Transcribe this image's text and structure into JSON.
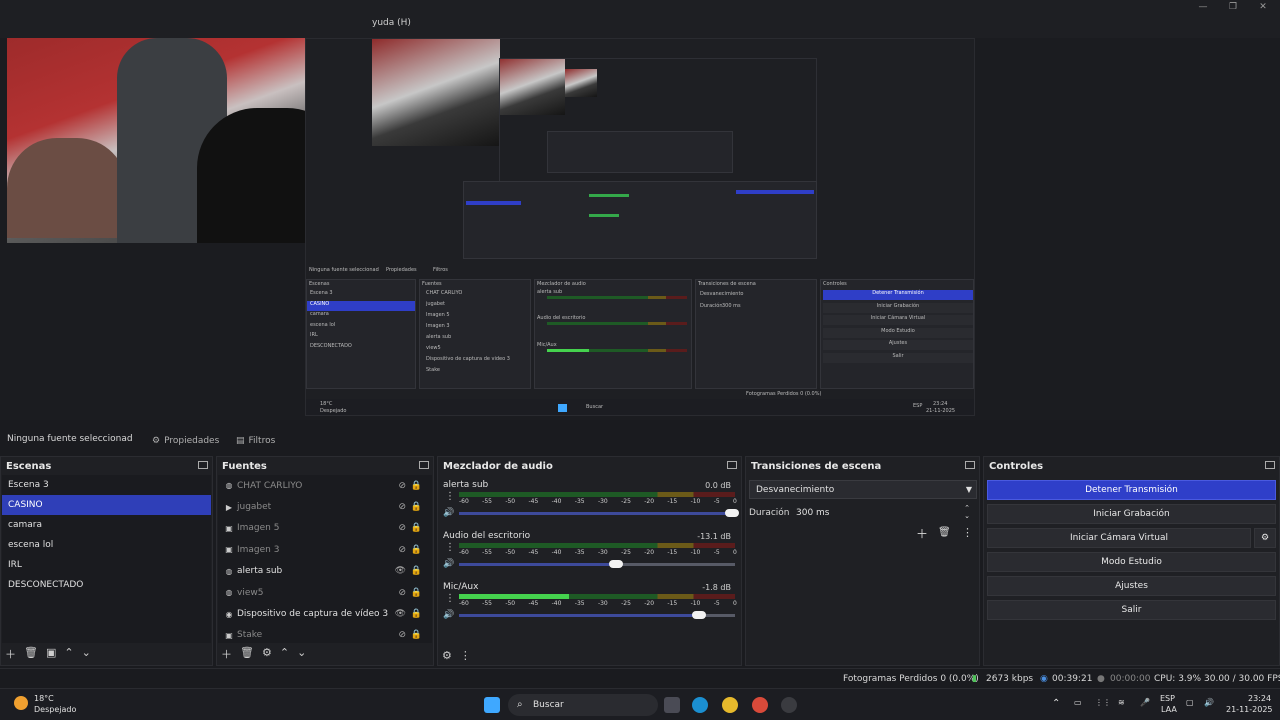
{
  "titlebar": {
    "menu_fragment": "yuda (H)"
  },
  "properties_bar": {
    "source_label": "Ninguna fuente seleccionad",
    "properties_button": "Propiedades",
    "filters_button": "Filtros"
  },
  "scenes": {
    "title": "Escenas",
    "items": [
      "Escena 3",
      "CASINO",
      "camara",
      "escena lol",
      "IRL",
      "DESCONECTADO"
    ],
    "selected_index": 1
  },
  "sources": {
    "title": "Fuentes",
    "items": [
      {
        "label": "CHAT CARLIYO",
        "icon": "browser-icon",
        "visible": false
      },
      {
        "label": "jugabet",
        "icon": "media-icon",
        "visible": false
      },
      {
        "label": "Imagen 5",
        "icon": "image-icon",
        "visible": false
      },
      {
        "label": "Imagen 3",
        "icon": "image-icon",
        "visible": false
      },
      {
        "label": "alerta sub",
        "icon": "browser-icon",
        "visible": true
      },
      {
        "label": "view5",
        "icon": "browser-icon",
        "visible": false
      },
      {
        "label": "Dispositivo de captura de vídeo 3",
        "icon": "camera-icon",
        "visible": true
      },
      {
        "label": "Stake",
        "icon": "image-icon",
        "visible": false
      }
    ]
  },
  "mixer": {
    "title": "Mezclador de audio",
    "scale": [
      "-60",
      "-55",
      "-50",
      "-45",
      "-40",
      "-35",
      "-30",
      "-25",
      "-20",
      "-15",
      "-10",
      "-5",
      "0"
    ],
    "channels": [
      {
        "name": "alerta sub",
        "db": "0.0 dB",
        "level": 0,
        "volume": 1.0
      },
      {
        "name": "Audio del escritorio",
        "db": "-13.1 dB",
        "level": 0,
        "volume": 0.58
      },
      {
        "name": "Mic/Aux",
        "db": "-1.8 dB",
        "level": 0.4,
        "volume": 0.88
      }
    ]
  },
  "transitions": {
    "title": "Transiciones de escena",
    "selected": "Desvanecimiento",
    "duration_label": "Duración",
    "duration_value": "300 ms"
  },
  "controls": {
    "title": "Controles",
    "buttons": [
      "Detener Transmisión",
      "Iniciar Grabación",
      "Iniciar Cámara Virtual",
      "Modo Estudio",
      "Ajustes",
      "Salir"
    ]
  },
  "status": {
    "dropped": "Fotogramas Perdidos 0 (0.0%)",
    "bitrate": "2673 kbps",
    "stream_time": "00:39:21",
    "rec_time": "00:00:00",
    "cpu": "CPU: 3.9%",
    "fps": "30.00 / 30.00 FPS"
  },
  "taskbar": {
    "weather_temp": "18°C",
    "weather_desc": "Despejado",
    "search": "Buscar",
    "lang1": "ESP",
    "lang2": "LAA",
    "time": "23:24",
    "date": "21-11-2025"
  },
  "nested_preview": {
    "scene_items": [
      "Escena 3",
      "CASINO",
      "camara",
      "escena lol",
      "IRL",
      "DESCONECTADO"
    ],
    "source_items": [
      "CHAT CARLIYO",
      "jugabet",
      "Imagen 5",
      "Imagen 3",
      "alerta sub",
      "view5",
      "Dispositivo de captura de video 3",
      "Stake"
    ],
    "controls": [
      "Detener Transmisión",
      "Iniciar Grabación",
      "Iniciar Cámara Virtual",
      "Modo Estudio",
      "Ajustes",
      "Salir"
    ],
    "prop_label": "Ninguna fuente seleccionad",
    "prop_btn": "Propiedades",
    "filt_btn": "Filtros",
    "scenes_title": "Escenas",
    "sources_title": "Fuentes",
    "mixer_title": "Mezclador de audio",
    "trans_title": "Transiciones de escena",
    "controls_title": "Controles",
    "trans_value": "Desvanecimiento",
    "dur_label": "Duración",
    "dur_value": "300 ms",
    "ch1": "alerta sub",
    "ch2": "Audio del escritorio",
    "ch3": "Mic/Aux",
    "status": "Fotogramas Perdidos 0 (0.0%)",
    "weather": "18°C",
    "weather_desc": "Despejado",
    "search": "Buscar",
    "lang": "ESP",
    "time": "23:24",
    "date": "21-11-2025"
  }
}
